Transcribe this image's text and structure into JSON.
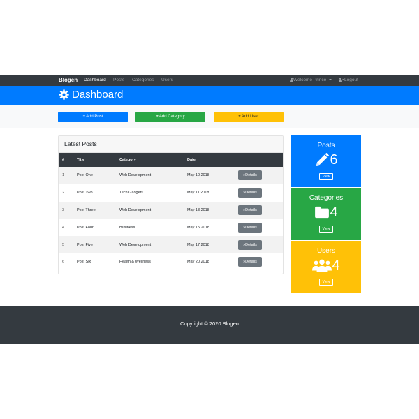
{
  "navbar": {
    "brand": "Blogen",
    "links": [
      "Dashboard",
      "Posts",
      "Categories",
      "Users"
    ],
    "active": "Dashboard",
    "user_menu": "Welcome Prince",
    "logout": "Logout"
  },
  "header": {
    "title": "Dashboard",
    "icon": "gear-icon"
  },
  "actions": {
    "add_post": "Add Post",
    "add_category": "Add Category",
    "add_user": "Add User"
  },
  "latest_posts": {
    "title": "Latest Posts",
    "columns": [
      "#",
      "Title",
      "Category",
      "Date",
      ""
    ],
    "rows": [
      {
        "num": "1",
        "title": "Post One",
        "category": "Web Development",
        "date": "May 10 2018",
        "action": "Details"
      },
      {
        "num": "2",
        "title": "Post Two",
        "category": "Tech Gadgets",
        "date": "May 11 2018",
        "action": "Details"
      },
      {
        "num": "3",
        "title": "Post Three",
        "category": "Web Development",
        "date": "May 13 2018",
        "action": "Details"
      },
      {
        "num": "4",
        "title": "Post Four",
        "category": "Business",
        "date": "May 15 2018",
        "action": "Details"
      },
      {
        "num": "5",
        "title": "Post Five",
        "category": "Web Development",
        "date": "May 17 2018",
        "action": "Details"
      },
      {
        "num": "6",
        "title": "Post Six",
        "category": "Health & Wellness",
        "date": "May 20 2018",
        "action": "Details"
      }
    ]
  },
  "stats": {
    "posts": {
      "title": "Posts",
      "count": "6",
      "view": "View",
      "icon": "pencil-icon"
    },
    "categories": {
      "title": "Categories",
      "count": "4",
      "view": "View",
      "icon": "folder-icon"
    },
    "users": {
      "title": "Users",
      "count": "4",
      "view": "View",
      "icon": "users-icon"
    }
  },
  "footer": {
    "text": "Copyright © 2020 Blogen"
  },
  "colors": {
    "primary": "#007bff",
    "success": "#28a745",
    "warning": "#ffc107",
    "dark": "#343a40",
    "secondary": "#6c757d"
  }
}
